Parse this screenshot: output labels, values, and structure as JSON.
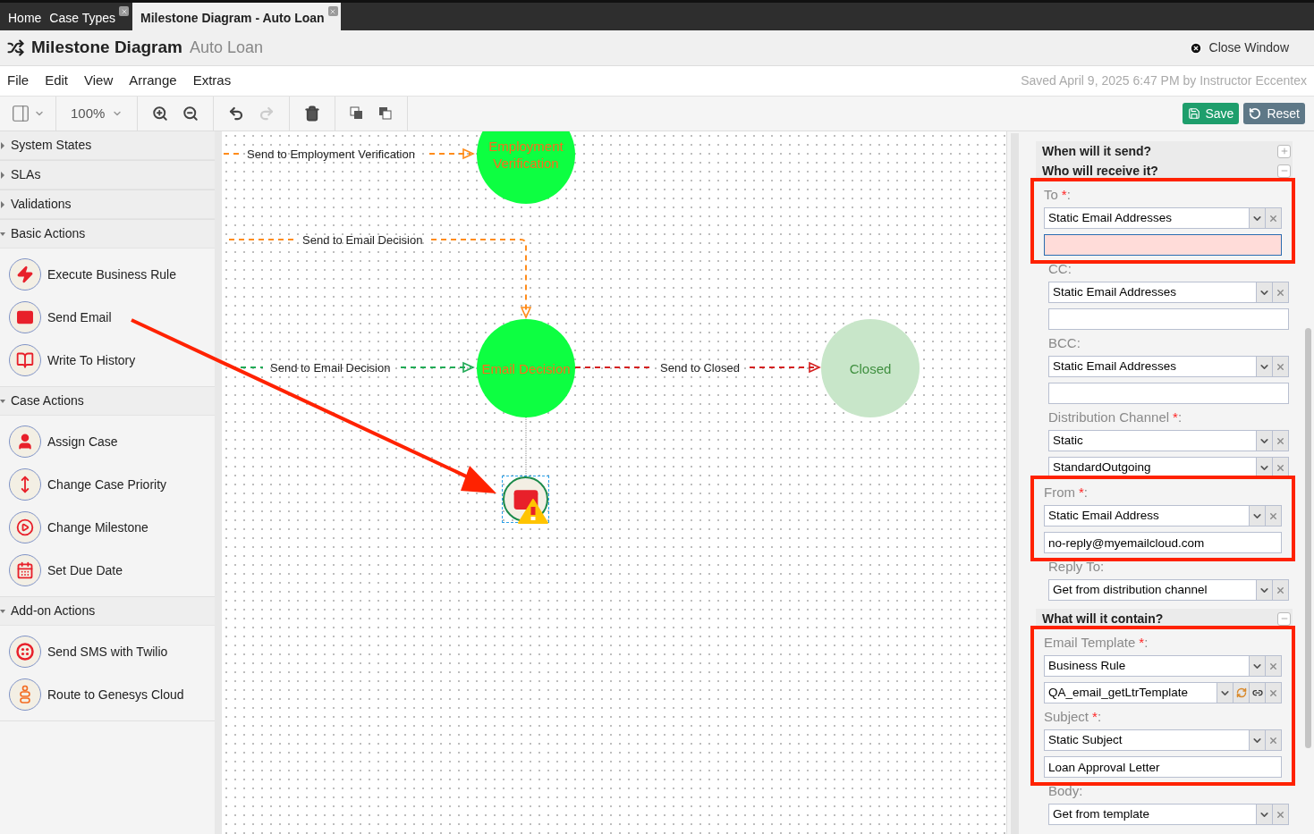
{
  "tabs": [
    {
      "label": "Home",
      "selected": false,
      "closable": false
    },
    {
      "label": "Case Types",
      "selected": false,
      "closable": true
    },
    {
      "label": "Milestone Diagram - Auto Loan",
      "selected": true,
      "closable": true
    }
  ],
  "header": {
    "title": "Milestone Diagram",
    "subtitle": "Auto Loan",
    "close_label": "Close Window"
  },
  "menu": [
    "File",
    "Edit",
    "View",
    "Arrange",
    "Extras"
  ],
  "saved_text": "Saved April 9, 2025 6:47 PM by Instructor Eccentex",
  "toolbar": {
    "zoom": "100%",
    "undo_disabled": false,
    "redo_disabled": true
  },
  "actions": [
    {
      "label": "Save",
      "kind": "primary"
    },
    {
      "label": "Reset",
      "kind": "secondary"
    }
  ],
  "sidebar": [
    {
      "title": "System States",
      "expanded": false
    },
    {
      "title": "SLAs",
      "expanded": false
    },
    {
      "title": "Validations",
      "expanded": false
    },
    {
      "title": "Basic Actions",
      "expanded": true,
      "items": [
        {
          "label": "Execute Business Rule",
          "kind": "rule"
        },
        {
          "label": "Send Email",
          "kind": "email"
        },
        {
          "label": "Write To History",
          "kind": "history"
        }
      ]
    },
    {
      "title": "Case Actions",
      "expanded": true,
      "items": [
        {
          "label": "Assign Case",
          "kind": "assign"
        },
        {
          "label": "Change Case Priority",
          "kind": "priority"
        },
        {
          "label": "Change Milestone",
          "kind": "milestone"
        },
        {
          "label": "Set Due Date",
          "kind": "date"
        }
      ]
    },
    {
      "title": "Add-on Actions",
      "expanded": true,
      "items": [
        {
          "label": "Send SMS with Twilio",
          "kind": "sms"
        },
        {
          "label": "Route to Genesys Cloud",
          "kind": "route"
        }
      ]
    }
  ],
  "diagram": {
    "nodes": [
      {
        "label": "Employment Verification",
        "color": "#0dff41"
      },
      {
        "label": "Email Decision",
        "color": "#0dff41"
      },
      {
        "label": "Closed",
        "color": "#c8e6c9"
      }
    ],
    "edges": [
      {
        "label": "Send to Employment Verification",
        "color": "#ff8c1a"
      },
      {
        "label": "Send to Email Decision",
        "color": "#ff8c1a"
      },
      {
        "label": "Send to Email Decision",
        "color": "#1faa55"
      },
      {
        "label": "Send to Closed",
        "color": "#d42020"
      }
    ],
    "action_node": {
      "warning": true,
      "selected": true
    }
  },
  "panel": [
    {
      "title": "When will it send?",
      "expanded": false
    },
    {
      "title": "Who will receive it?",
      "expanded": true,
      "groups": [
        {
          "annotated": true,
          "fields": [
            {
              "label": "To",
              "asterisk": "*",
              "colon": ":",
              "controls": [
                {
                  "kind": "select",
                  "value": "Static Email Addresses"
                },
                {
                  "kind": "input",
                  "error": true
                }
              ]
            }
          ]
        },
        {
          "annotated": false,
          "fields": [
            {
              "label": "CC",
              "colon": ":",
              "controls": [
                {
                  "kind": "select",
                  "value": "Static Email Addresses"
                },
                {
                  "kind": "input",
                  "error": false
                }
              ]
            },
            {
              "label": "BCC",
              "colon": ":",
              "controls": [
                {
                  "kind": "select",
                  "value": "Static Email Addresses"
                },
                {
                  "kind": "input",
                  "error": false
                }
              ]
            },
            {
              "label": "Distribution Channel",
              "asterisk": "*",
              "colon": ":",
              "controls": [
                {
                  "kind": "select",
                  "value": "Static"
                },
                {
                  "kind": "select",
                  "value": "StandardOutgoing"
                }
              ]
            }
          ]
        },
        {
          "annotated": true,
          "fields": [
            {
              "label": "From",
              "asterisk": "*",
              "colon": ":",
              "controls": [
                {
                  "kind": "select",
                  "value": "Static Email Address"
                },
                {
                  "kind": "input",
                  "value": "no-reply@myemailcloud.com",
                  "error": false
                }
              ]
            }
          ]
        },
        {
          "annotated": false,
          "fields": [
            {
              "label": "Reply To",
              "colon": ":",
              "controls": [
                {
                  "kind": "select",
                  "value": "Get from distribution channel"
                }
              ]
            }
          ]
        }
      ]
    },
    {
      "title": "What will it contain?",
      "expanded": true,
      "groups": [
        {
          "annotated": true,
          "fields": [
            {
              "label": "Email Template",
              "asterisk": "*",
              "colon": ":",
              "controls": [
                {
                  "kind": "select",
                  "value": "Business Rule"
                },
                {
                  "kind": "rule_select",
                  "value": "QA_email_getLtrTemplate"
                }
              ]
            },
            {
              "label": "Subject",
              "asterisk": "*",
              "colon": ":",
              "controls": [
                {
                  "kind": "select",
                  "value": "Static Subject"
                },
                {
                  "kind": "input",
                  "value": "Loan Approval Letter",
                  "error": false
                }
              ]
            }
          ]
        },
        {
          "annotated": false,
          "fields": [
            {
              "label": "Body",
              "colon": ":",
              "controls": [
                {
                  "kind": "select",
                  "value": "Get from template"
                }
              ]
            }
          ]
        }
      ]
    }
  ]
}
